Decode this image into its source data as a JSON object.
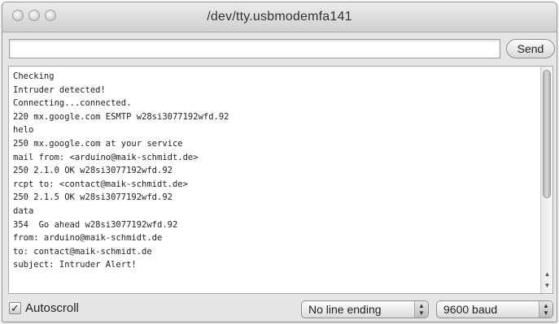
{
  "window": {
    "title": "/dev/tty.usbmodemfa141"
  },
  "input": {
    "value": "",
    "send_label": "Send"
  },
  "console": {
    "lines": [
      "Checking",
      "Intruder detected!",
      "Connecting...connected.",
      "220 mx.google.com ESMTP w28si3077192wfd.92",
      "helo",
      "250 mx.google.com at your service",
      "mail from: <arduino@maik-schmidt.de>",
      "250 2.1.0 OK w28si3077192wfd.92",
      "rcpt to: <contact@maik-schmidt.de>",
      "250 2.1.5 OK w28si3077192wfd.92",
      "data",
      "354  Go ahead w28si3077192wfd.92",
      "from: arduino@maik-schmidt.de",
      "to: contact@maik-schmidt.de",
      "subject: Intruder Alert!"
    ]
  },
  "footer": {
    "autoscroll_label": "Autoscroll",
    "autoscroll_checked": true,
    "line_ending": "No line ending",
    "baud_rate": "9600 baud"
  },
  "icons": {
    "checkmark": "✓",
    "stepper": "▲▼"
  }
}
